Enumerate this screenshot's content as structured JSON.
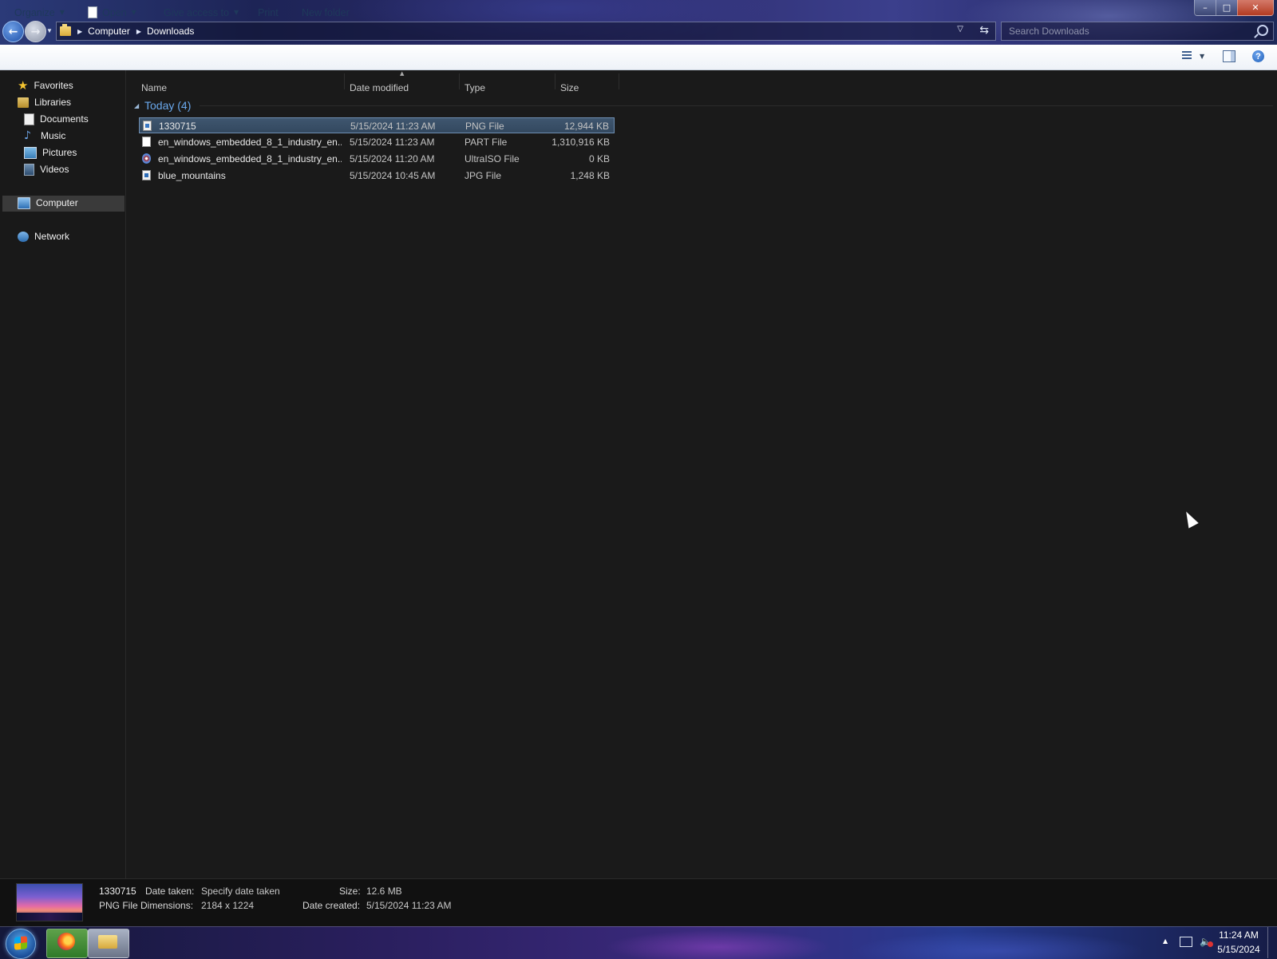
{
  "window": {
    "controls": {
      "minimize": "–",
      "maximize": "□",
      "close": "✕"
    }
  },
  "address": {
    "breadcrumbs": [
      "Computer",
      "Downloads"
    ],
    "search_placeholder": "Search Downloads"
  },
  "commandbar": {
    "organize": "Organize",
    "open": "Open",
    "give_access": "Give access to",
    "print": "Print",
    "new_folder": "New folder"
  },
  "nav": {
    "favorites": "Favorites",
    "libraries": "Libraries",
    "documents": "Documents",
    "music": "Music",
    "pictures": "Pictures",
    "videos": "Videos",
    "computer": "Computer",
    "network": "Network"
  },
  "columns": {
    "name": "Name",
    "date": "Date modified",
    "type": "Type",
    "size": "Size"
  },
  "group": {
    "label": "Today (4)"
  },
  "files": [
    {
      "name": "1330715",
      "date": "5/15/2024 11:23 AM",
      "type": "PNG File",
      "size": "12,944 KB",
      "icon": "png-file-icon",
      "selected": true
    },
    {
      "name": "en_windows_embedded_8_1_industry_en...",
      "date": "5/15/2024 11:23 AM",
      "type": "PART File",
      "size": "1,310,916 KB",
      "icon": "part-file-icon",
      "selected": false
    },
    {
      "name": "en_windows_embedded_8_1_industry_en...",
      "date": "5/15/2024 11:20 AM",
      "type": "UltraISO File",
      "size": "0 KB",
      "icon": "ultraiso-file-icon",
      "selected": false
    },
    {
      "name": "blue_mountains",
      "date": "5/15/2024 10:45 AM",
      "type": "JPG File",
      "size": "1,248 KB",
      "icon": "jpg-file-icon",
      "selected": false
    }
  ],
  "details": {
    "name": "1330715",
    "filetype": "PNG File",
    "date_taken_label": "Date taken:",
    "date_taken_value": "Specify date taken",
    "dimensions_label": "Dimensions:",
    "dimensions_value": "2184 x 1224",
    "size_label": "Size:",
    "size_value": "12.6 MB",
    "date_created_label": "Date created:",
    "date_created_value": "5/15/2024 11:23 AM"
  },
  "taskbar": {
    "time": "11:24 AM",
    "date": "5/15/2024"
  },
  "colors": {
    "accent": "#6aa9ee",
    "selection": "#3f566f",
    "background": "#1a1a1a"
  }
}
